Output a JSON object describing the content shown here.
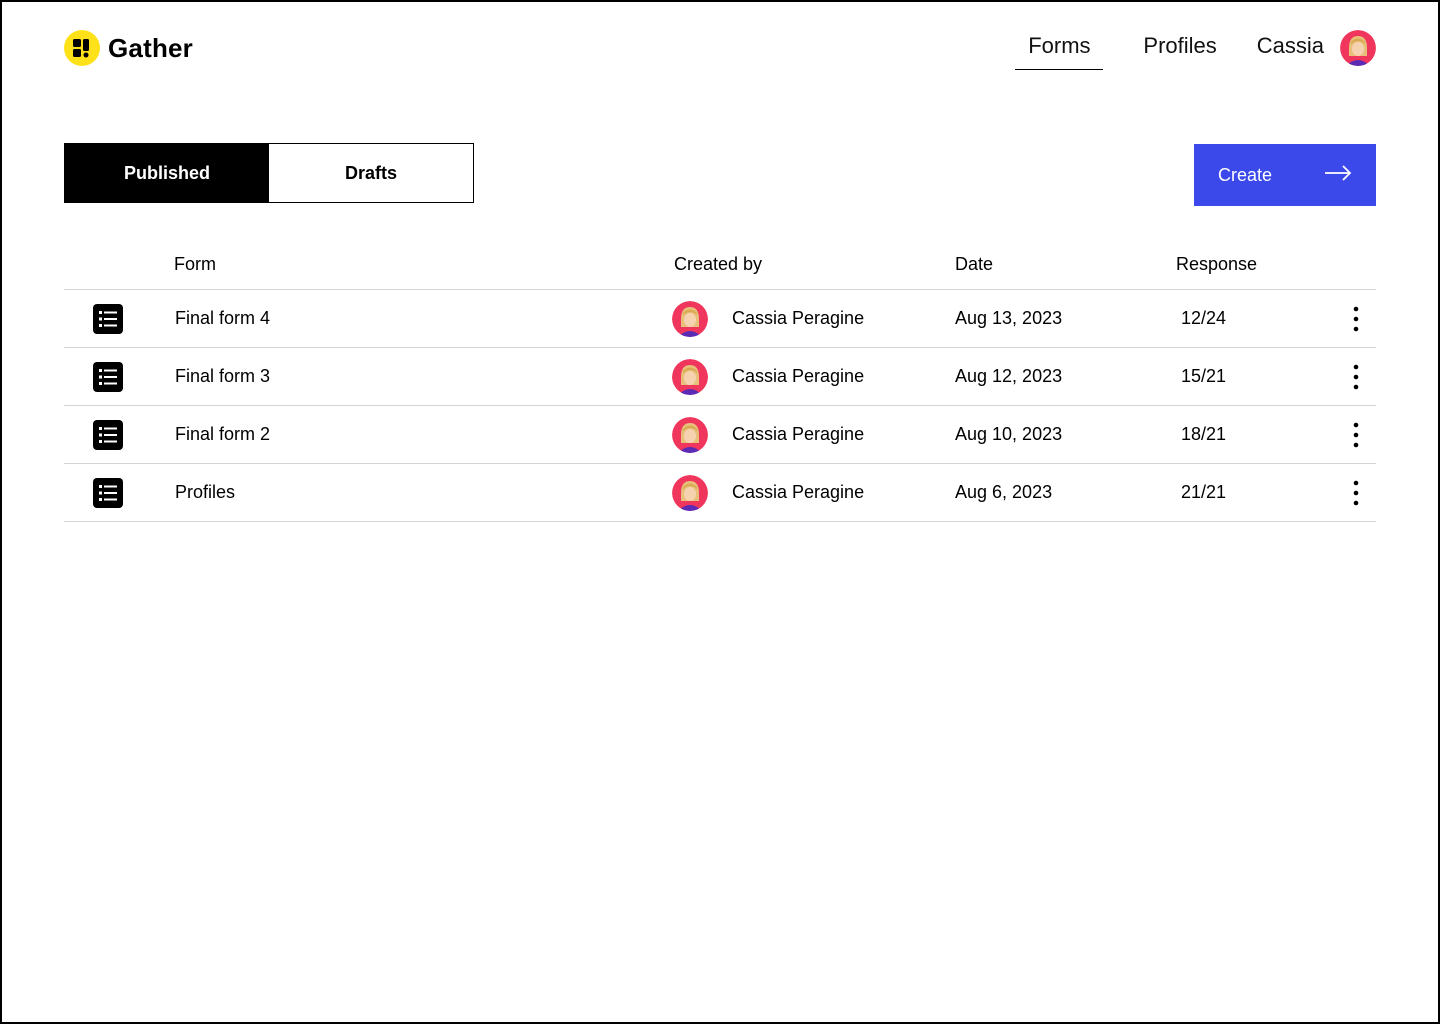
{
  "app": {
    "name": "Gather",
    "logo_icon": "gather-logo-icon",
    "brand_color": "#ffe11a"
  },
  "nav": {
    "items": [
      {
        "label": "Forms",
        "active": true
      },
      {
        "label": "Profiles",
        "active": false
      }
    ],
    "user_name": "Cassia"
  },
  "tabs": [
    {
      "label": "Published",
      "active": true
    },
    {
      "label": "Drafts",
      "active": false
    }
  ],
  "create_button": {
    "label": "Create",
    "icon": "arrow-right-icon",
    "color": "#3b49eb"
  },
  "table": {
    "headers": {
      "form": "Form",
      "created_by": "Created by",
      "date": "Date",
      "response": "Response"
    },
    "rows": [
      {
        "name": "Final form 4",
        "author": "Cassia Peragine",
        "date": "Aug 13, 2023",
        "response": "12/24"
      },
      {
        "name": "Final form 3",
        "author": "Cassia Peragine",
        "date": "Aug 12, 2023",
        "response": "15/21"
      },
      {
        "name": "Final form 2",
        "author": "Cassia Peragine",
        "date": "Aug 10, 2023",
        "response": "18/21"
      },
      {
        "name": "Profiles",
        "author": "Cassia Peragine",
        "date": "Aug 6, 2023",
        "response": "21/21"
      }
    ]
  }
}
